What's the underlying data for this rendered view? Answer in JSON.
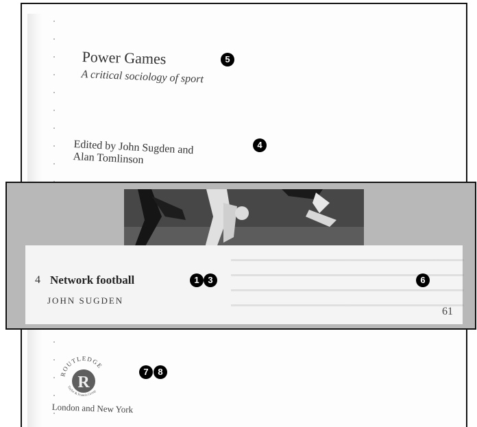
{
  "book": {
    "title": "Power Games",
    "subtitle": "A critical sociology of sport",
    "editors_line1": "Edited by John Sugden and",
    "editors_line2": "Alan Tomlinson",
    "publisher_logo_text": "ROUTLEDGE",
    "publisher_logo_subtext": "Taylor & Francis Group",
    "location": "London and New York"
  },
  "chapter": {
    "number": "4",
    "title": "Network football",
    "author": "JOHN SUGDEN",
    "page": "61"
  },
  "markers": {
    "m1": "1",
    "m3": "3",
    "m4": "4",
    "m5": "5",
    "m6": "6",
    "m7": "7",
    "m8": "8"
  },
  "colors": {
    "band": "#b8b8b8",
    "marker": "#000000",
    "logo": "#5e5e5e"
  }
}
